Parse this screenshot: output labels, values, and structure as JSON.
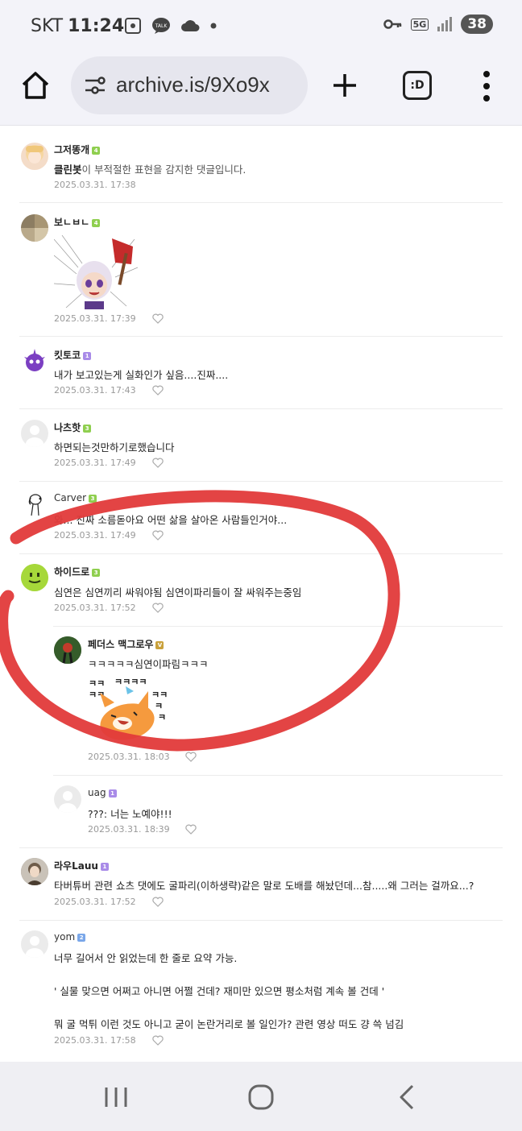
{
  "status_bar": {
    "carrier": "SKT",
    "time": "11:24",
    "network": "5G",
    "battery": "38"
  },
  "browser": {
    "url": "archive.is/9Xo9x",
    "icons": [
      "home-icon",
      "tune-icon",
      "plus-icon",
      "emoji-extension-icon",
      "more-vert-icon"
    ],
    "extension_label": ":D"
  },
  "comments": [
    {
      "nick": "그저똥개",
      "level": "4",
      "level_color": "#8fcf4f",
      "text_bold": "클린봇",
      "text": "이 부적절한 표현을 감지한 댓글입니다.",
      "date": "2025.03.31. 17:38"
    },
    {
      "nick": "보ㄴㅂㄴ",
      "level": "4",
      "level_color": "#8fcf4f",
      "text": "",
      "sticker": "anime-girl-axe-sticker",
      "date": "2025.03.31. 17:39"
    },
    {
      "nick": "킷토코",
      "level": "1",
      "level_color": "#a98be8",
      "text": "내가 보고있는게 실화인가 싶음....진짜....",
      "date": "2025.03.31. 17:43"
    },
    {
      "nick": "나츠핫",
      "level": "3",
      "level_color": "#8fcf4f",
      "text": "하면되는것만하기로했습니다",
      "date": "2025.03.31. 17:49"
    },
    {
      "nick": "Carver",
      "level": "3",
      "level_color": "#8fcf4f",
      "text": "와... 진짜 소름돋아요 어떤 삶을 살아온 사람들인거야...",
      "date": "2025.03.31. 17:49"
    },
    {
      "nick": "하이드로",
      "level": "3",
      "level_color": "#8fcf4f",
      "text": "심연은 심연끼리 싸워야됨 심연이파리들이 잘 싸워주는중임",
      "date": "2025.03.31. 17:52"
    },
    {
      "nick": "페더스 맥그로우",
      "level": "V",
      "level_color": "#c9a13b",
      "text": "ㅋㅋㅋㅋㅋ심연이파림ㅋㅋㅋ",
      "sticker": "laughing-fox-sticker",
      "date": "2025.03.31. 18:03"
    },
    {
      "nick": "uag",
      "level": "1",
      "level_color": "#a98be8",
      "text": "???: 너는 노예야!!!",
      "date": "2025.03.31. 18:39"
    },
    {
      "nick": "라우Lauu",
      "level": "1",
      "level_color": "#a98be8",
      "text": "타버튜버 관련 쇼츠 댓에도 굴파리(이하생략)같은 말로 도배를 해놨던데...참.....왜 그러는 걸까요...?",
      "date": "2025.03.31. 17:52"
    },
    {
      "nick": "yom",
      "level": "2",
      "level_color": "#7aa7e9",
      "text_lines": [
        "너무 길어서 안 읽었는데 한 줄로 요약 가능.",
        "' 실물 맞으면 어쩌고 아니면 어쩔 건데? 재미만 있으면 평소처럼 계속 볼 건데 '",
        "뭐 굴 먹튀 이런 것도 아니고 굳이 논란거리로 볼 일인가? 관련 영상 떠도 걍 쓱 넘김"
      ],
      "date": "2025.03.31. 17:58"
    }
  ],
  "annotation": {
    "shape": "red-hand-drawn-circle",
    "color": "#e23a3a"
  },
  "nav_bar": {
    "icons": [
      "recents-icon",
      "home-circle-icon",
      "back-icon"
    ]
  }
}
